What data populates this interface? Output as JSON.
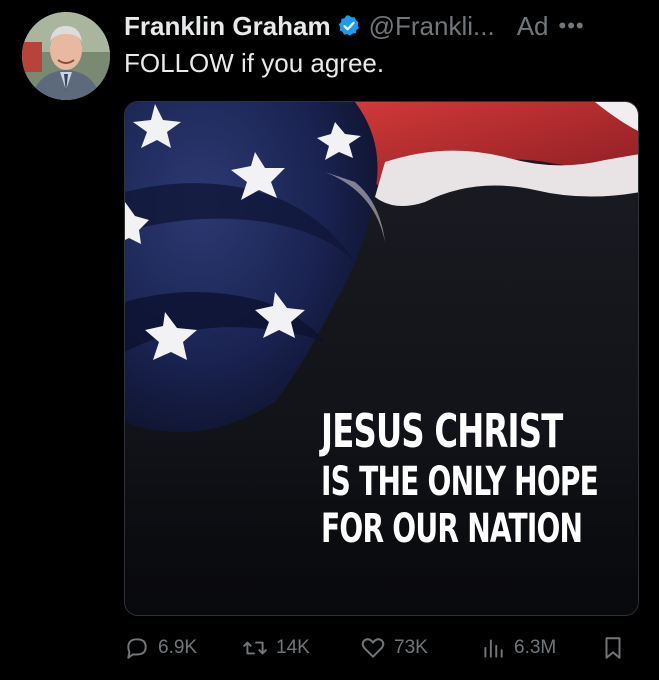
{
  "author": {
    "name": "Franklin Graham",
    "handle": "@Frankli...",
    "verified": true,
    "ad_label": "Ad",
    "more_icon": "more-horizontal-icon"
  },
  "tweet": {
    "text": "FOLLOW if you agree."
  },
  "media": {
    "line1": "JESUS CHRIST",
    "line2": "IS THE ONLY HOPE",
    "line3": "FOR OUR NATION"
  },
  "actions": {
    "replies": "6.9K",
    "retweets": "14K",
    "likes": "73K",
    "views": "6.3M"
  },
  "colors": {
    "background": "#000000",
    "text": "#e7e9ea",
    "muted": "#71767b",
    "verified": "#1d9bf0"
  }
}
